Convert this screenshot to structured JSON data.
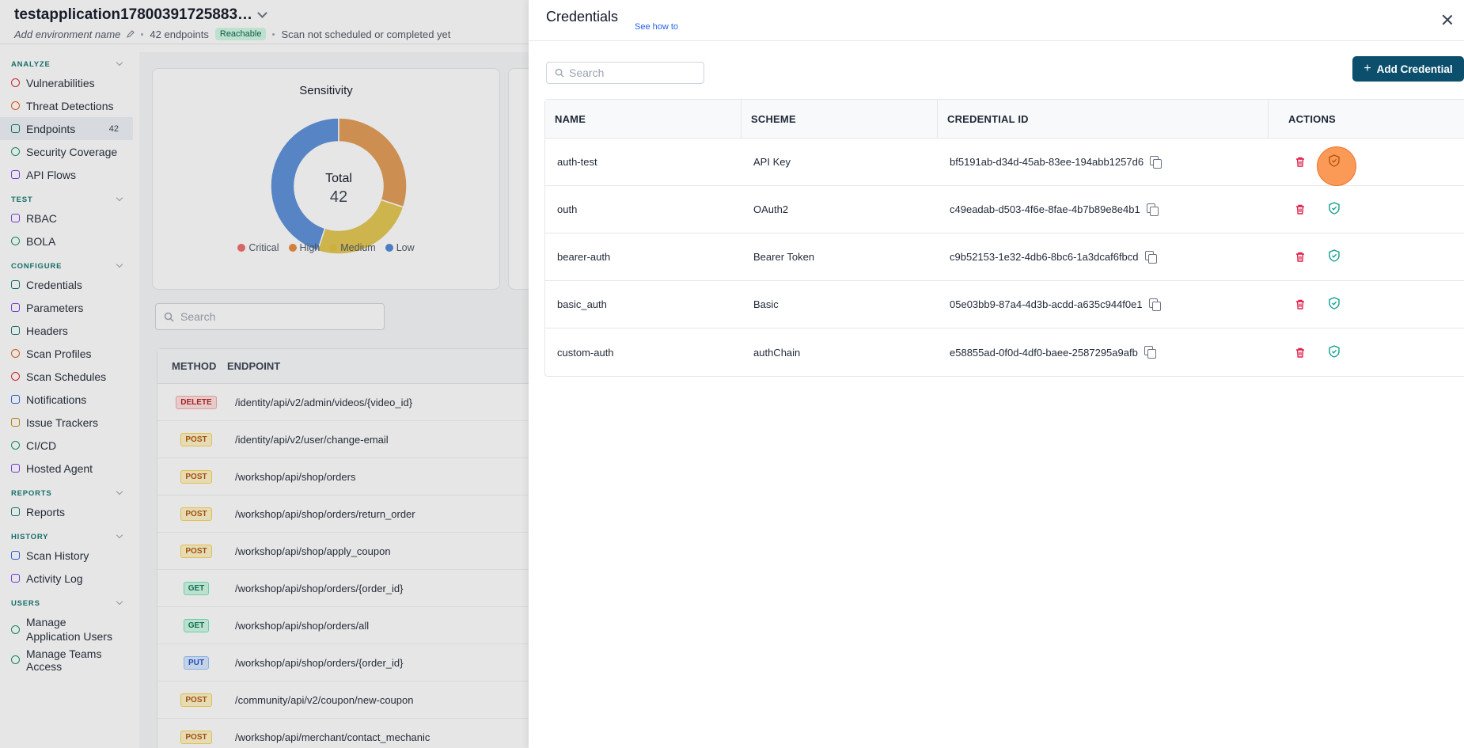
{
  "app": {
    "title": "testapplication17800391725883…",
    "env_placeholder": "Add environment name",
    "endpoints_count": "42 endpoints",
    "status": "Reachable",
    "scan_status": "Scan not scheduled or completed yet"
  },
  "sidebar": {
    "sections": [
      {
        "heading": "ANALYZE",
        "items": [
          {
            "label": "Vulnerabilities",
            "icon": "shield-alert-icon"
          },
          {
            "label": "Threat Detections",
            "icon": "radar-icon"
          },
          {
            "label": "Endpoints",
            "icon": "endpoints-icon",
            "badge": "42",
            "active": true
          },
          {
            "label": "Security Coverage",
            "icon": "coverage-icon"
          },
          {
            "label": "API Flows",
            "icon": "flows-icon"
          }
        ]
      },
      {
        "heading": "TEST",
        "items": [
          {
            "label": "RBAC",
            "icon": "users-icon"
          },
          {
            "label": "BOLA",
            "icon": "shield-icon"
          }
        ]
      },
      {
        "heading": "CONFIGURE",
        "items": [
          {
            "label": "Credentials",
            "icon": "key-icon"
          },
          {
            "label": "Parameters",
            "icon": "braces-icon"
          },
          {
            "label": "Headers",
            "icon": "headers-icon"
          },
          {
            "label": "Scan Profiles",
            "icon": "gauge-icon"
          },
          {
            "label": "Scan Schedules",
            "icon": "calendar-icon"
          },
          {
            "label": "Notifications",
            "icon": "bell-icon"
          },
          {
            "label": "Issue Trackers",
            "icon": "tracker-icon"
          },
          {
            "label": "CI/CD",
            "icon": "pipeline-icon"
          },
          {
            "label": "Hosted Agent",
            "icon": "agent-icon"
          }
        ]
      },
      {
        "heading": "REPORTS",
        "items": [
          {
            "label": "Reports",
            "icon": "report-icon"
          }
        ]
      },
      {
        "heading": "HISTORY",
        "items": [
          {
            "label": "Scan History",
            "icon": "history-icon"
          },
          {
            "label": "Activity Log",
            "icon": "log-icon"
          }
        ]
      },
      {
        "heading": "USERS",
        "items": [
          {
            "label": "Manage Application Users",
            "icon": "users-icon"
          },
          {
            "label": "Manage Teams Access",
            "icon": "team-icon"
          }
        ]
      }
    ]
  },
  "sensitivity": {
    "title": "Sensitivity",
    "total_label": "Total",
    "total_value": "42",
    "legend": [
      {
        "label": "Critical",
        "color": "#ef6b6b"
      },
      {
        "label": "High",
        "color": "#e88a3c"
      },
      {
        "label": "Medium",
        "color": "#e3c23c"
      },
      {
        "label": "Low",
        "color": "#4f86d6"
      }
    ],
    "segments": [
      {
        "label": "High",
        "fraction": 0.3,
        "color": "#e39a55"
      },
      {
        "label": "Medium",
        "fraction": 0.25,
        "color": "#e3c64f"
      },
      {
        "label": "Low",
        "fraction": 0.45,
        "color": "#5a8fd8"
      }
    ]
  },
  "endpoints": {
    "search_placeholder": "Search",
    "headers": {
      "method": "METHOD",
      "endpoint": "ENDPOINT"
    },
    "rows": [
      {
        "method": "DELETE",
        "path": "/identity/api/v2/admin/videos/{video_id}"
      },
      {
        "method": "POST",
        "path": "/identity/api/v2/user/change-email"
      },
      {
        "method": "POST",
        "path": "/workshop/api/shop/orders"
      },
      {
        "method": "POST",
        "path": "/workshop/api/shop/orders/return_order"
      },
      {
        "method": "POST",
        "path": "/workshop/api/shop/apply_coupon"
      },
      {
        "method": "GET",
        "path": "/workshop/api/shop/orders/{order_id}"
      },
      {
        "method": "GET",
        "path": "/workshop/api/shop/orders/all"
      },
      {
        "method": "PUT",
        "path": "/workshop/api/shop/orders/{order_id}"
      },
      {
        "method": "POST",
        "path": "/community/api/v2/coupon/new-coupon"
      },
      {
        "method": "POST",
        "path": "/workshop/api/merchant/contact_mechanic"
      }
    ]
  },
  "drawer": {
    "title": "Credentials",
    "help_link": "See how to",
    "search_placeholder": "Search",
    "add_button": "Add Credential",
    "headers": {
      "name": "NAME",
      "scheme": "SCHEME",
      "id": "CREDENTIAL ID",
      "actions": "ACTIONS"
    },
    "rows": [
      {
        "name": "auth-test",
        "scheme": "API Key",
        "id": "bf5191ab-d34d-45ab-83ee-194abb1257d6"
      },
      {
        "name": "outh",
        "scheme": "OAuth2",
        "id": "c49eadab-d503-4f6e-8fae-4b7b89e8e4b1"
      },
      {
        "name": "bearer-auth",
        "scheme": "Bearer Token",
        "id": "c9b52153-1e32-4db6-8bc6-1a3dcaf6fbcd"
      },
      {
        "name": "basic_auth",
        "scheme": "Basic",
        "id": "05e03bb9-87a4-4d3b-acdd-a635c944f0e1"
      },
      {
        "name": "custom-auth",
        "scheme": "authChain",
        "id": "e58855ad-0f0d-4df0-baee-2587295a9afb"
      }
    ],
    "colors": {
      "delete": "#e11d48",
      "verify": "#0f9f8f",
      "primary": "#0b4f6c"
    }
  }
}
